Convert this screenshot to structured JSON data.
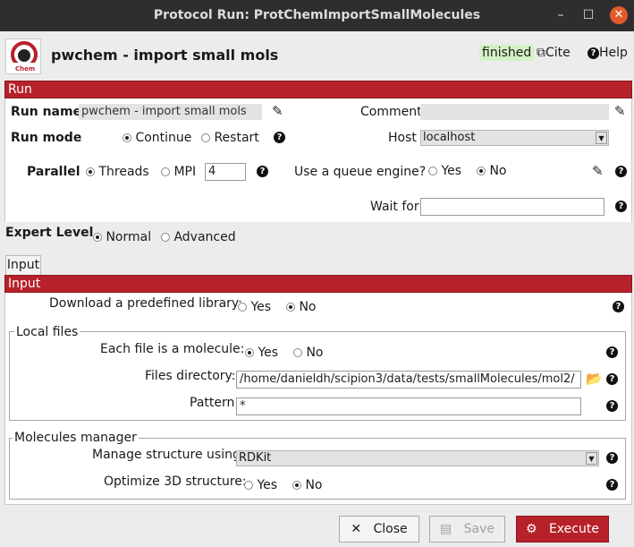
{
  "window": {
    "title": "Protocol Run: ProtChemImportSmallMolecules",
    "minimize": "–",
    "maximize": "☐",
    "close": "✕"
  },
  "header": {
    "logo_text": "Chem",
    "protocol_title": "pwchem - import small mols",
    "status": "finished",
    "cite_label": "Cite",
    "help_label": "Help"
  },
  "run_section": {
    "bar_label": "Run",
    "run_name_label": "Run name",
    "run_name_value": "pwchem - import small mols",
    "comment_label": "Comment",
    "comment_value": "",
    "run_mode_label": "Run mode",
    "run_mode_options": [
      "Continue",
      "Restart"
    ],
    "run_mode_selected": "Continue",
    "host_label": "Host",
    "host_value": "localhost",
    "parallel_label": "Parallel",
    "parallel_options": [
      "Threads",
      "MPI"
    ],
    "parallel_selected": "Threads",
    "parallel_value": "4",
    "queue_label": "Use a queue engine?",
    "queue_options": [
      "Yes",
      "No"
    ],
    "queue_selected": "No",
    "wait_for_label": "Wait for",
    "wait_for_value": ""
  },
  "expert": {
    "label": "Expert Level",
    "options": [
      "Normal",
      "Advanced"
    ],
    "selected": "Normal"
  },
  "tabs": [
    "Input"
  ],
  "input_section": {
    "bar_label": "Input",
    "download_label": "Download a predefined library:",
    "download_options": [
      "Yes",
      "No"
    ],
    "download_selected": "No",
    "local_files": {
      "legend": "Local files",
      "each_file_label": "Each file is a molecule:",
      "each_file_options": [
        "Yes",
        "No"
      ],
      "each_file_selected": "Yes",
      "files_dir_label": "Files directory:",
      "files_dir_value": "/home/danieldh/scipion3/data/tests/smallMolecules/mol2/",
      "pattern_label": "Pattern",
      "pattern_value": "*"
    },
    "molecules_manager": {
      "legend": "Molecules manager",
      "manage_label": "Manage structure using:",
      "manage_value": "RDKit",
      "optimize_label": "Optimize 3D structure:",
      "optimize_options": [
        "Yes",
        "No"
      ],
      "optimize_selected": "No"
    }
  },
  "footer": {
    "close_label": "Close",
    "save_label": "Save",
    "execute_label": "Execute"
  },
  "icons": {
    "help": "?",
    "pencil": "✎",
    "folder": "📂",
    "external_link": "⧉"
  },
  "colors": {
    "accent_red": "#b7212a",
    "status_green": "#d4f1c6"
  }
}
